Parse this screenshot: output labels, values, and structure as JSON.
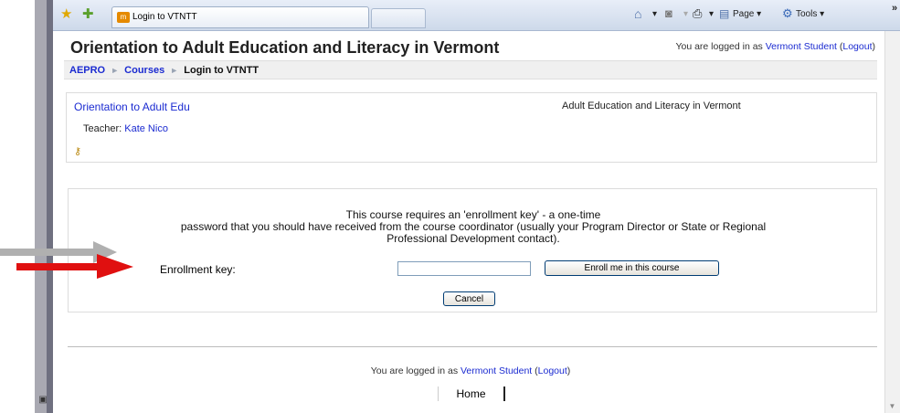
{
  "browser": {
    "tab_title": "Login to VTNTT",
    "tab_favicon_text": "m",
    "page_menu": "Page",
    "tools_menu": "Tools",
    "more_chevron": "»",
    "caret": "▾"
  },
  "header": {
    "title": "Orientation to Adult Education and Literacy in Vermont",
    "login_prefix": "You are logged in as ",
    "user_name": "Vermont Student",
    "logout_label": "Logout",
    "paren_open": " (",
    "paren_close": ")"
  },
  "breadcrumb": {
    "items": [
      "AEPRO",
      "Courses"
    ],
    "current": "Login to VTNTT",
    "separator": "►"
  },
  "course": {
    "name": "Orientation to Adult Edu",
    "summary": "Adult Education and Literacy in Vermont",
    "teacher_label": "Teacher: ",
    "teacher_name": "Kate Nico"
  },
  "enrolment": {
    "message_line1": "This course requires an 'enrollment key' - a one-time",
    "message_line2": "password that you should have received from the course coordinator (usually your Program Director or State or Regional",
    "message_line3": "Professional Development contact).",
    "key_label": "Enrollment key:",
    "key_value": "",
    "enrol_button": "Enroll me in this course",
    "cancel_button": "Cancel"
  },
  "footer": {
    "login_prefix": "You are logged in as ",
    "user_name": "Vermont Student",
    "logout_label": "Logout",
    "paren_open": " (",
    "paren_close": ")",
    "home_label": "Home"
  },
  "colors": {
    "link": "#1b2bd1",
    "arrow_red": "#e01010",
    "arrow_gray": "#b0b0b0"
  },
  "icons": {
    "favorites_star": "star-icon",
    "add_favorites": "add-favorite-icon",
    "home": "home-icon",
    "feeds": "feeds-icon",
    "print": "print-icon",
    "page": "page-icon",
    "tools": "gear-icon",
    "key": "key-icon"
  }
}
